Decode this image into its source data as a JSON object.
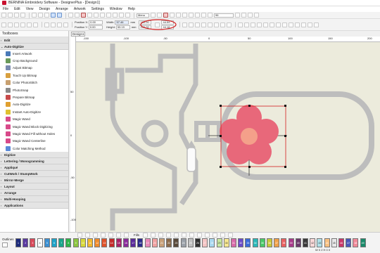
{
  "window": {
    "title": "BERNINA Embroidery Software - DesignerPlus - [Design1]"
  },
  "menu": [
    "File",
    "Edit",
    "View",
    "Design",
    "Arrange",
    "Artwork",
    "Settings",
    "Window",
    "Help"
  ],
  "toolbar": {
    "zoom_dropdown": "Menu",
    "stitch_count": "96",
    "position_x_label": "Position X:",
    "position_y_label": "Position Y:",
    "position_x": "0.00",
    "position_y": "0.00",
    "width_label": "Width:",
    "height_label": "Height:",
    "width": "57.46",
    "height": "53.19",
    "unit": "mm",
    "scale_w": "100.00",
    "scale_h": "100.00",
    "scale_unit": "%",
    "val_a": "44.59",
    "val_b": "44.16"
  },
  "panel": {
    "title": "Toolboxes",
    "groups": [
      {
        "label": "Edit",
        "expanded": false
      },
      {
        "label": "Auto-Digitize",
        "expanded": true,
        "items": [
          "Insert Artwork",
          "Crop Background",
          "Adjust Bitmap",
          "Touch Up Bitmap",
          "Color PhotoStitch",
          "PhotoSnap",
          "Prepare Bitmap",
          "Auto-Digitize",
          "Instant Auto-Digitize",
          "Magic Wand",
          "Magic Wand Block Digitizing",
          "Magic Wand Fill without Holes",
          "Magic Wand Centerline",
          "Color Matching Method"
        ]
      },
      {
        "label": "Digitize",
        "expanded": false
      },
      {
        "label": "Lettering / Monogramming",
        "expanded": false
      },
      {
        "label": "Appliqué",
        "expanded": false
      },
      {
        "label": "CutWork / StumpWork",
        "expanded": false
      },
      {
        "label": "Mirror-Merge",
        "expanded": false
      },
      {
        "label": "Layout",
        "expanded": false
      },
      {
        "label": "Arrange",
        "expanded": false
      },
      {
        "label": "Multi-Hooping",
        "expanded": false
      },
      {
        "label": "Applications",
        "expanded": false
      }
    ]
  },
  "document": {
    "tab": "Design1"
  },
  "ruler_top": [
    "-150",
    "-100",
    "-50",
    "0",
    "50",
    "100",
    "150",
    "200"
  ],
  "ruler_left": [
    "50",
    "0",
    "-50",
    "-100"
  ],
  "bottom": {
    "outlines_label": "Outlines",
    "fills_label": "Fills",
    "colors": [
      {
        "label": "1",
        "hex": "#1c2a7a"
      },
      {
        "label": "2",
        "hex": "#5a3aa0"
      },
      {
        "label": "3",
        "hex": "#d84a5a"
      },
      {
        "label": "4",
        "hex": "#ffffff"
      },
      {
        "label": "5",
        "hex": "#3b8fd1"
      },
      {
        "label": "6",
        "hex": "#1fa3c9"
      },
      {
        "label": "7",
        "hex": "#1aa58a"
      },
      {
        "label": "8",
        "hex": "#2fb34a"
      },
      {
        "label": "9",
        "hex": "#8bc53f"
      },
      {
        "label": "10",
        "hex": "#d8d83a"
      },
      {
        "label": "11",
        "hex": "#f2b82e"
      },
      {
        "label": "12",
        "hex": "#f08a2a"
      },
      {
        "label": "13",
        "hex": "#e0522a"
      },
      {
        "label": "14",
        "hex": "#c42a2a"
      },
      {
        "label": "15",
        "hex": "#a8226a"
      },
      {
        "label": "16",
        "hex": "#8a2a9a"
      },
      {
        "label": "17",
        "hex": "#5a2a9a"
      },
      {
        "label": "18",
        "hex": "#2a2a8a"
      },
      {
        "label": "19",
        "hex": "#e888b8"
      },
      {
        "label": "20",
        "hex": "#f0a0a0"
      },
      {
        "label": "21",
        "hex": "#c8a078"
      },
      {
        "label": "22",
        "hex": "#8a6a4a"
      },
      {
        "label": "23",
        "hex": "#5a4a3a"
      },
      {
        "label": "24",
        "hex": "#9aa0a8"
      },
      {
        "label": "25",
        "hex": "#c0c0c0"
      },
      {
        "label": "26",
        "hex": "#303030"
      },
      {
        "label": "27",
        "hex": "#f4c4c4"
      },
      {
        "label": "28",
        "hex": "#a8d8f0"
      },
      {
        "label": "29",
        "hex": "#c8e8a0"
      },
      {
        "label": "30",
        "hex": "#f8e890"
      },
      {
        "label": "31",
        "hex": "#d86aa8"
      },
      {
        "label": "32",
        "hex": "#6a4ac8"
      },
      {
        "label": "33",
        "hex": "#3a6ad8"
      },
      {
        "label": "34",
        "hex": "#2ab8b8"
      },
      {
        "label": "35",
        "hex": "#48c868"
      },
      {
        "label": "36",
        "hex": "#c8c838"
      },
      {
        "label": "37",
        "hex": "#f0a048"
      },
      {
        "label": "38",
        "hex": "#e86060"
      },
      {
        "label": "39",
        "hex": "#a83a8a"
      },
      {
        "label": "40",
        "hex": "#6a3a6a"
      },
      {
        "label": "41",
        "hex": "#3a3a3a"
      },
      {
        "label": "42",
        "hex": "#f8d8d8"
      },
      {
        "label": "43",
        "hex": "#b0e0e8"
      },
      {
        "label": "44",
        "hex": "#f8c080"
      },
      {
        "label": "45",
        "hex": "#e8e8e8"
      },
      {
        "label": "46",
        "hex": "#c83868"
      },
      {
        "label": "47",
        "hex": "#4858b8"
      },
      {
        "label": "48",
        "hex": "#f08898"
      },
      {
        "label": "49",
        "hex": "#1a8a6a"
      }
    ],
    "status": "W  0 2 H  0 0"
  },
  "colors": {
    "accent": "#2b579a",
    "flower_petal": "#e8687a",
    "flower_center": "#f4a08a",
    "hoop": "#bebebe",
    "canvas": "#ecebdc"
  }
}
